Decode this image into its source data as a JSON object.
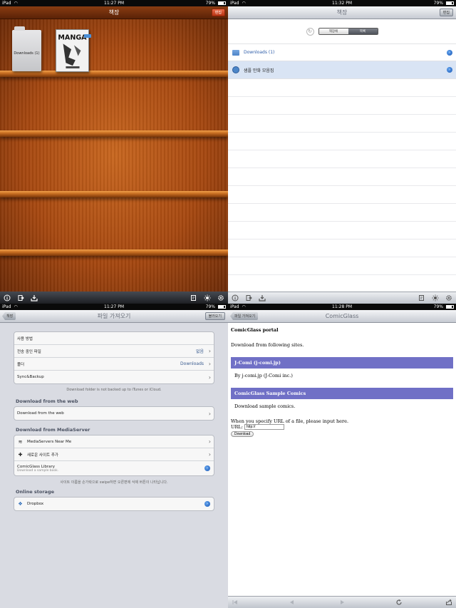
{
  "status": {
    "device": "iPad",
    "battery": "79%",
    "battery_level": 0.79,
    "times": [
      "11:27 PM",
      "11:32 PM",
      "11:27 PM",
      "11:28 PM"
    ]
  },
  "shelf": {
    "title": "책장",
    "edit_label": "편집",
    "folder_label": "Downloads (1)",
    "manga_title": "MANGA"
  },
  "list": {
    "title": "책장",
    "edit_label": "편집",
    "segment": [
      "책장에",
      "목록"
    ],
    "items": [
      {
        "label": "Downloads (1)"
      },
      {
        "label": "샘플 만화 모음집"
      }
    ]
  },
  "import": {
    "title": "파일 가져오기",
    "back_label": "책장",
    "right_label": "불러오기",
    "group1": [
      {
        "label": "사용 방법",
        "value": ""
      },
      {
        "label": "전송 중인 파일",
        "value": "없음"
      },
      {
        "label": "폴더",
        "value": "Downloads"
      },
      {
        "label": "Sync&Backup",
        "value": ""
      }
    ],
    "note1": "Download folder is not backed up to iTunes or iCloud.",
    "sec_web": "Download from the web",
    "web_row": "Download from the web",
    "sec_media": "Download from MediaServer",
    "media_rows": [
      {
        "label": "MediaServers Near Me"
      },
      {
        "label": "새로운 사이트 추가"
      }
    ],
    "library_title": "ComicGlass Library",
    "library_sub": "Download a sample book.",
    "note2": "사이트 이름을 손가락으로 swipe하면 오른편에 삭제 버튼이 나타납니다.",
    "sec_storage": "Online storage",
    "storage_row": "Dropbox"
  },
  "portal": {
    "title": "ComicGlass",
    "back_label": "파일 가져오기",
    "heading": "ComicGlass portal",
    "intro": "Download from following sites.",
    "site1_title": "J-Comi (j-comi.jp)",
    "site1_desc": "By j-comi.jp (J-Comi inc.)",
    "site2_title": "ComicGlass Sample Comics",
    "site2_desc": "Download sample comics.",
    "url_prompt": "When you specify URL of a file, please input here.",
    "url_label": "URL:",
    "url_value": "http://",
    "download_label": "Download"
  },
  "colors": {
    "wood": "#a74810",
    "accent_blue": "#1f5cb8",
    "portal_bar": "#7070c6"
  }
}
